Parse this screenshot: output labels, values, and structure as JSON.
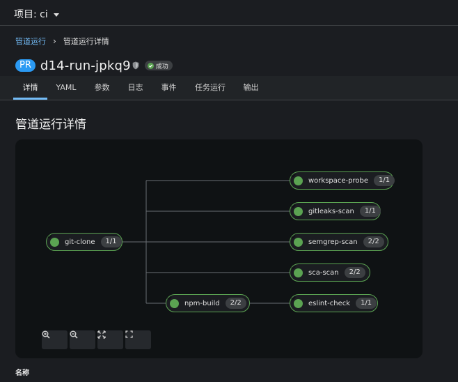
{
  "topbar": {
    "project_label": "项目: ci"
  },
  "breadcrumb": {
    "parent": "管道运行",
    "separator": "›",
    "current": "管道运行详情"
  },
  "header": {
    "pr_badge": "PR",
    "run_name": "d14-run-jpkq9",
    "status": "成功"
  },
  "tabs": [
    {
      "label": "详情",
      "active": true
    },
    {
      "label": "YAML"
    },
    {
      "label": "参数"
    },
    {
      "label": "日志"
    },
    {
      "label": "事件"
    },
    {
      "label": "任务运行"
    },
    {
      "label": "输出"
    }
  ],
  "section_title": "管道运行详情",
  "graph": {
    "nodes": [
      {
        "name": "git-clone",
        "count": "1/1",
        "status": "succeeded"
      },
      {
        "name": "workspace-probe",
        "count": "1/1",
        "status": "succeeded"
      },
      {
        "name": "gitleaks-scan",
        "count": "1/1",
        "status": "succeeded"
      },
      {
        "name": "semgrep-scan",
        "count": "2/2",
        "status": "succeeded"
      },
      {
        "name": "sca-scan",
        "count": "2/2",
        "status": "succeeded"
      },
      {
        "name": "npm-build",
        "count": "2/2",
        "status": "succeeded"
      },
      {
        "name": "eslint-check",
        "count": "1/1",
        "status": "succeeded"
      }
    ],
    "controls": [
      "zoom-in-icon",
      "zoom-out-icon",
      "fit-to-screen-icon",
      "fullscreen-icon"
    ],
    "colors": {
      "success": "#5ba352",
      "edge": "#6a6e73",
      "panel": "#0f1214"
    }
  },
  "details": {
    "name_heading": "名称"
  }
}
